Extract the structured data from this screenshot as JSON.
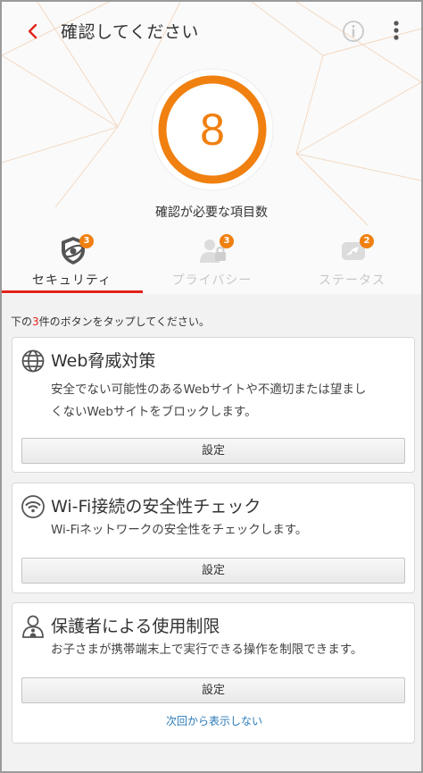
{
  "header": {
    "title": "確認してください",
    "count": "8",
    "caption": "確認が必要な項目数"
  },
  "tabs": [
    {
      "label": "セキュリティ",
      "badge": "3",
      "active": true,
      "icon": "shield-icon"
    },
    {
      "label": "プライバシー",
      "badge": "3",
      "active": false,
      "icon": "privacy-icon"
    },
    {
      "label": "ステータス",
      "badge": "2",
      "active": false,
      "icon": "status-icon"
    }
  ],
  "instruction": {
    "prefix": "下の",
    "count": "3",
    "suffix": "件のボタンをタップしてください。"
  },
  "cards": [
    {
      "title": "Web脅威対策",
      "desc_line1": "安全でない可能性のあるWebサイトや不適切または望まし",
      "desc_line2": "くないWebサイトをブロックします。",
      "button": "設定",
      "icon": "globe-icon"
    },
    {
      "title": "Wi-Fi接続の安全性チェック",
      "desc_line1": "Wi-Fiネットワークの安全性をチェックします。",
      "button": "設定",
      "icon": "wifi-icon"
    },
    {
      "title": "保護者による使用制限",
      "desc_line1": "お子さまが携帯端末上で実行できる操作を制限できます。",
      "button": "設定",
      "icon": "parental-icon",
      "dismiss": "次回から表示しない"
    }
  ],
  "colors": {
    "accent": "#f08010",
    "active_tab": "#e2231a",
    "link": "#2a7ab8"
  }
}
